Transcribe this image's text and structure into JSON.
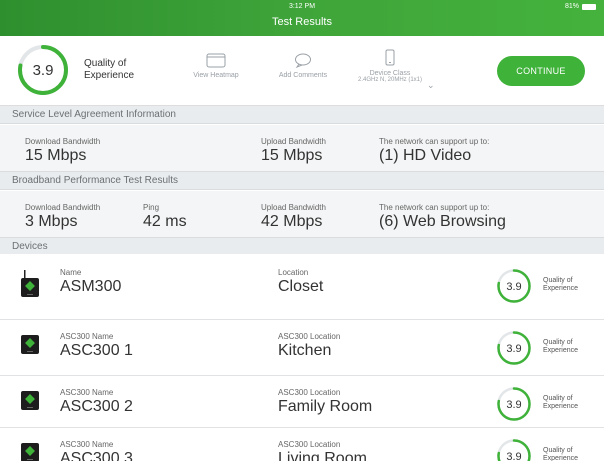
{
  "status_bar": {
    "time": "3:12 PM",
    "battery": "81%"
  },
  "title": "Test Results",
  "summary": {
    "qoe_score": "3.9",
    "qoe_fraction": 0.78,
    "qoe_label_line1": "Quality of",
    "qoe_label_line2": "Experience",
    "actions": {
      "view_heatmap": "View Heatmap",
      "add_comments": "Add Comments",
      "device_class": "Device Class",
      "device_class_value": "2.4GHz N, 20MHz (1x1)"
    },
    "continue_label": "CONTINUE"
  },
  "sla": {
    "header": "Service Level Agreement Information",
    "download_label": "Download Bandwidth",
    "download_value": "15 Mbps",
    "upload_label": "Upload Bandwidth",
    "upload_value": "15 Mbps",
    "support_label": "The network can support up to:",
    "support_value": "(1) HD Video"
  },
  "broadband": {
    "header": "Broadband Performance Test Results",
    "download_label": "Download Bandwidth",
    "download_value": "3 Mbps",
    "ping_label": "Ping",
    "ping_value": "42 ms",
    "upload_label": "Upload Bandwidth",
    "upload_value": "42 Mbps",
    "support_label": "The network can support up to:",
    "support_value": "(6) Web Browsing"
  },
  "devices": {
    "header": "Devices",
    "items": [
      {
        "name_label": "Name",
        "name": "ASM300",
        "loc_label": "Location",
        "location": "Closet",
        "score": "3.9",
        "score_fraction": 0.78,
        "q1": "Quality of",
        "q2": "Experience"
      },
      {
        "name_label": "ASC300 Name",
        "name": "ASC300 1",
        "loc_label": "ASC300 Location",
        "location": "Kitchen",
        "score": "3.9",
        "score_fraction": 0.78,
        "q1": "Quality of",
        "q2": "Experience"
      },
      {
        "name_label": "ASC300 Name",
        "name": "ASC300 2",
        "loc_label": "ASC300 Location",
        "location": "Family Room",
        "score": "3.9",
        "score_fraction": 0.78,
        "q1": "Quality of",
        "q2": "Experience"
      },
      {
        "name_label": "ASC300 Name",
        "name": "ASC300 3",
        "loc_label": "ASC300 Location",
        "location": "Living Room",
        "score": "3.9",
        "score_fraction": 0.78,
        "q1": "Quality of",
        "q2": "Experience"
      }
    ]
  },
  "colors": {
    "accent": "#3fb23a",
    "ring_track": "#e3e6e8",
    "brand_dark": "#2e8f2e"
  }
}
